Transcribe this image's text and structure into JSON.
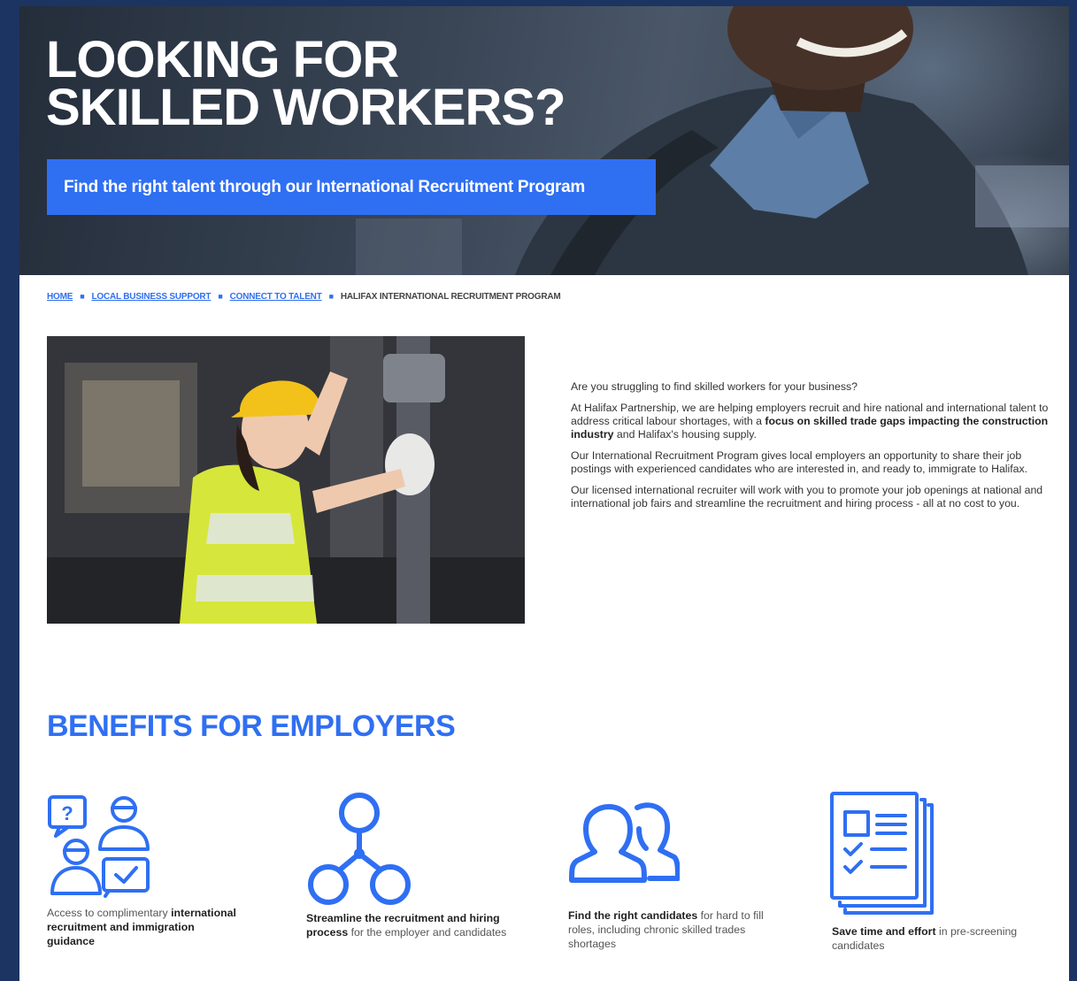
{
  "hero": {
    "title_line1": "LOOKING FOR",
    "title_line2": "SKILLED WORKERS?",
    "cta_label": "Find the right talent through our International Recruitment Program"
  },
  "breadcrumb": [
    {
      "label": "HOME",
      "link": true
    },
    {
      "label": "LOCAL BUSINESS SUPPORT",
      "link": true
    },
    {
      "label": "CONNECT TO TALENT",
      "link": true
    },
    {
      "label": "HALIFAX INTERNATIONAL RECRUITMENT PROGRAM",
      "link": false
    }
  ],
  "intro": {
    "p1": "Are you struggling to find skilled workers for your business?",
    "p2_a": "At Halifax Partnership, we are helping employers recruit and hire national and international talent to address critical labour shortages, with a ",
    "p2_bold": "focus on skilled trade gaps impacting the construction industry",
    "p2_b": " and Halifax's housing supply.",
    "p3": "Our International Recruitment Program gives local employers an opportunity to share their job postings with experienced candidates who are interested in, and ready to, immigrate to Halifax.",
    "p4": "Our licensed international recruiter will work with you to promote your job openings at national and international job fairs and streamline the recruitment and hiring process - all at no cost to you."
  },
  "benefits": {
    "title": "BENEFITS FOR EMPLOYERS",
    "items": [
      {
        "icon": "consultation-icon",
        "pre": "Access to complimentary ",
        "bold": "international recruitment and immigration guidance",
        "post": ""
      },
      {
        "icon": "network-icon",
        "pre": "",
        "bold": "Streamline the recruitment and hiring process",
        "post": " for the employer and candidates"
      },
      {
        "icon": "people-icon",
        "pre": "",
        "bold": "Find the right candidates",
        "post": " for hard to fill roles, including chronic skilled trades shortages"
      },
      {
        "icon": "checklist-icon",
        "pre": "",
        "bold": "Save time and effort",
        "post": " in pre-screening candidates"
      }
    ]
  },
  "colors": {
    "accent": "#2f6ff2",
    "frame": "#1c3461"
  }
}
